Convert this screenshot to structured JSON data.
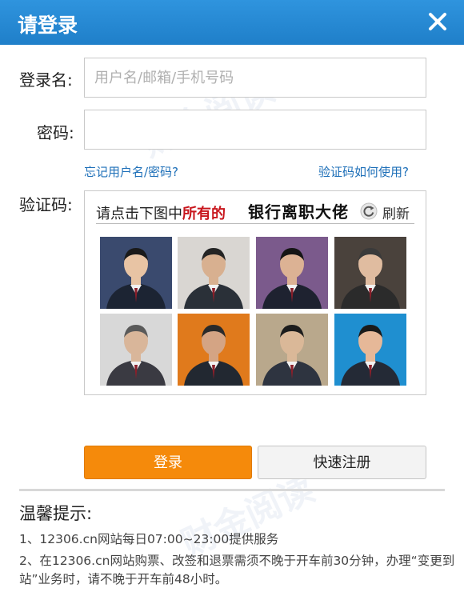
{
  "dialog": {
    "title": "请登录"
  },
  "form": {
    "username_label": "登录名:",
    "username_placeholder": "用户名/邮箱/手机号码",
    "username_value": "",
    "password_label": "密码:",
    "password_value": "",
    "forgot_link": "忘记用户名/密码?",
    "captcha_help_link": "验证码如何使用?",
    "captcha_label": "验证码:"
  },
  "captcha": {
    "prompt_prefix": "请点击下图中",
    "prompt_highlight": "所有的",
    "target": "银行离职大佬",
    "refresh_label": "刷新",
    "tiles": [
      {
        "bg": "#3a4a6e",
        "suit": "#1c2433",
        "skin": "#e8c4a4",
        "hair": "#1a1a1a"
      },
      {
        "bg": "#d9d6d2",
        "suit": "#2a3038",
        "skin": "#d8b090",
        "hair": "#242424"
      },
      {
        "bg": "#7b5a8c",
        "suit": "#1e2230",
        "skin": "#dcb294",
        "hair": "#151515"
      },
      {
        "bg": "#4a423c",
        "suit": "#2b2b2b",
        "skin": "#e0bca0",
        "hair": "#3a3a3a"
      },
      {
        "bg": "#d8d8d8",
        "suit": "#3a3a42",
        "skin": "#d9b69a",
        "hair": "#5a5a5a"
      },
      {
        "bg": "#e07a1c",
        "suit": "#222831",
        "skin": "#d4a484",
        "hair": "#2a2a2a"
      },
      {
        "bg": "#b9a88c",
        "suit": "#2e3440",
        "skin": "#dab898",
        "hair": "#1c1c1c"
      },
      {
        "bg": "#1f8fd0",
        "suit": "#242a36",
        "skin": "#e6b898",
        "hair": "#1a1a1a"
      }
    ]
  },
  "buttons": {
    "login": "登录",
    "register": "快速注册"
  },
  "tips": {
    "title": "温馨提示:",
    "items": [
      "1、12306.cn网站每日07:00~23:00提供服务",
      "2、在12306.cn网站购票、改签和退票需须不晚于开车前30分钟，办理“变更到站”业务时，请不晚于开车前48小时。"
    ]
  },
  "watermark": {
    "text": "财金阅读"
  },
  "colors": {
    "titlebar": "#2388d4",
    "accent_orange": "#f58a0b",
    "link_blue": "#1d6fb8",
    "highlight_red": "#c8161d"
  }
}
